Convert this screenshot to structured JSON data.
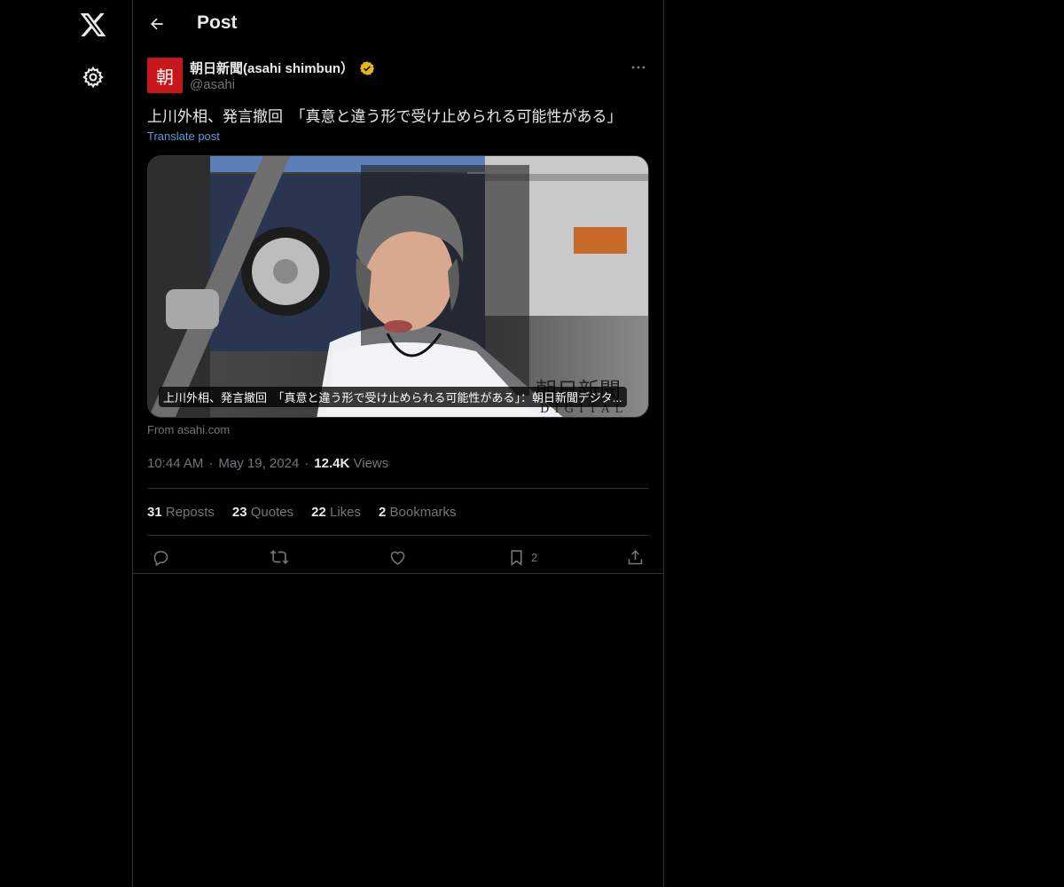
{
  "header": {
    "title": "Post"
  },
  "author": {
    "avatar_text": "朝",
    "display_name": "朝日新聞(asahi shimbun）",
    "handle": "@asahi",
    "verified": true
  },
  "post": {
    "text": "上川外相、発言撤回　「真意と違う形で受け止められる可能性がある」",
    "translate_label": "Translate post",
    "card_caption": "上川外相、発言撤回　「真意と違う形で受け止められる可能性がある」：朝日新聞デジタ...",
    "card_watermark_top": "朝日新聞",
    "card_watermark_bottom": "DIGITAL",
    "from_label": "From asahi.com"
  },
  "meta": {
    "time": "10:44 AM",
    "date": "May 19, 2024",
    "views_count": "12.4K",
    "views_label": "Views",
    "separator": "·"
  },
  "stats": [
    {
      "count": "31",
      "label": "Reposts"
    },
    {
      "count": "23",
      "label": "Quotes"
    },
    {
      "count": "22",
      "label": "Likes"
    },
    {
      "count": "2",
      "label": "Bookmarks"
    }
  ],
  "actions": {
    "bookmark_count": "2"
  },
  "colors": {
    "accent_link": "#5b9ad8",
    "verified_gold": "#e2b719",
    "avatar_red": "#c8161d"
  },
  "icons": [
    "x-logo-icon",
    "gear-icon",
    "back-arrow-icon",
    "verified-icon",
    "more-icon",
    "reply-icon",
    "repost-icon",
    "like-icon",
    "bookmark-icon",
    "share-icon"
  ]
}
